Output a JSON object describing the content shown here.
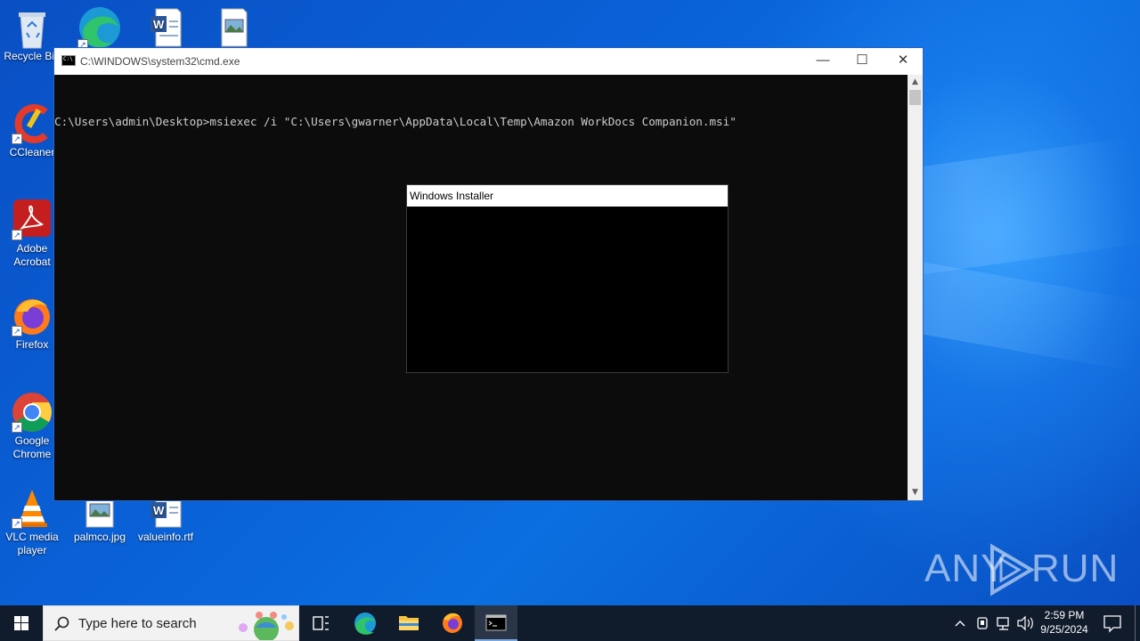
{
  "desktop": {
    "icons": [
      {
        "label": "Recycle Bin"
      },
      {
        "label": "CCleaner"
      },
      {
        "label": "Adobe Acrobat"
      },
      {
        "label": "Firefox"
      },
      {
        "label": "Google Chrome"
      },
      {
        "label": "VLC media player"
      },
      {
        "label": "palmco.jpg"
      },
      {
        "label": "valueinfo.rtf"
      }
    ]
  },
  "cmd_window": {
    "title": "C:\\WINDOWS\\system32\\cmd.exe",
    "command_line": "C:\\Users\\admin\\Desktop>msiexec /i \"C:\\Users\\gwarner\\AppData\\Local\\Temp\\Amazon WorkDocs Companion.msi\"",
    "minimize": "—",
    "maximize": "☐",
    "close": "✕"
  },
  "installer_dialog": {
    "title": "Windows Installer"
  },
  "watermark": {
    "left": "ANY",
    "right": "RUN"
  },
  "taskbar": {
    "search_placeholder": "Type here to search",
    "clock_time": "2:59 PM",
    "clock_date": "9/25/2024"
  }
}
